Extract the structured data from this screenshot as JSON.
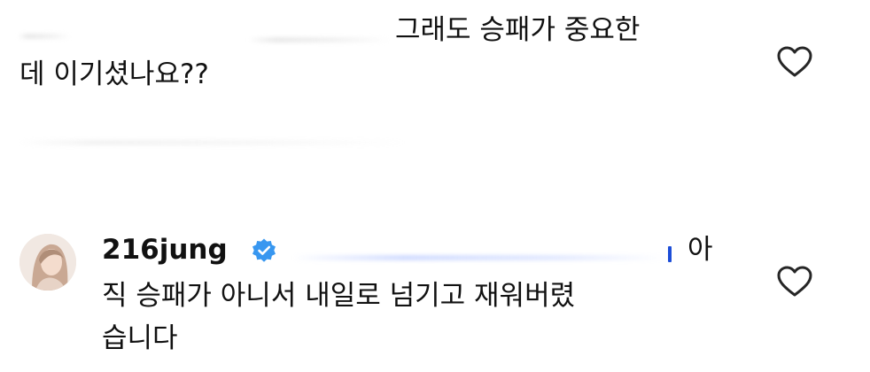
{
  "comments": [
    {
      "text_line_1": "그래도 승패가 중요한",
      "text_line_2": "데 이기셨나요??",
      "like_icon": "heart-outline-icon"
    },
    {
      "username": "216jung",
      "verified_icon": "verified-badge-icon",
      "text_line_1_tail": "아",
      "text_line_2": "직 승패가 아니서 내일로 넘기고 재워버렸",
      "text_line_3": "습니다",
      "like_icon": "heart-outline-icon",
      "colors": {
        "verified_badge": "#3897f0"
      }
    }
  ]
}
